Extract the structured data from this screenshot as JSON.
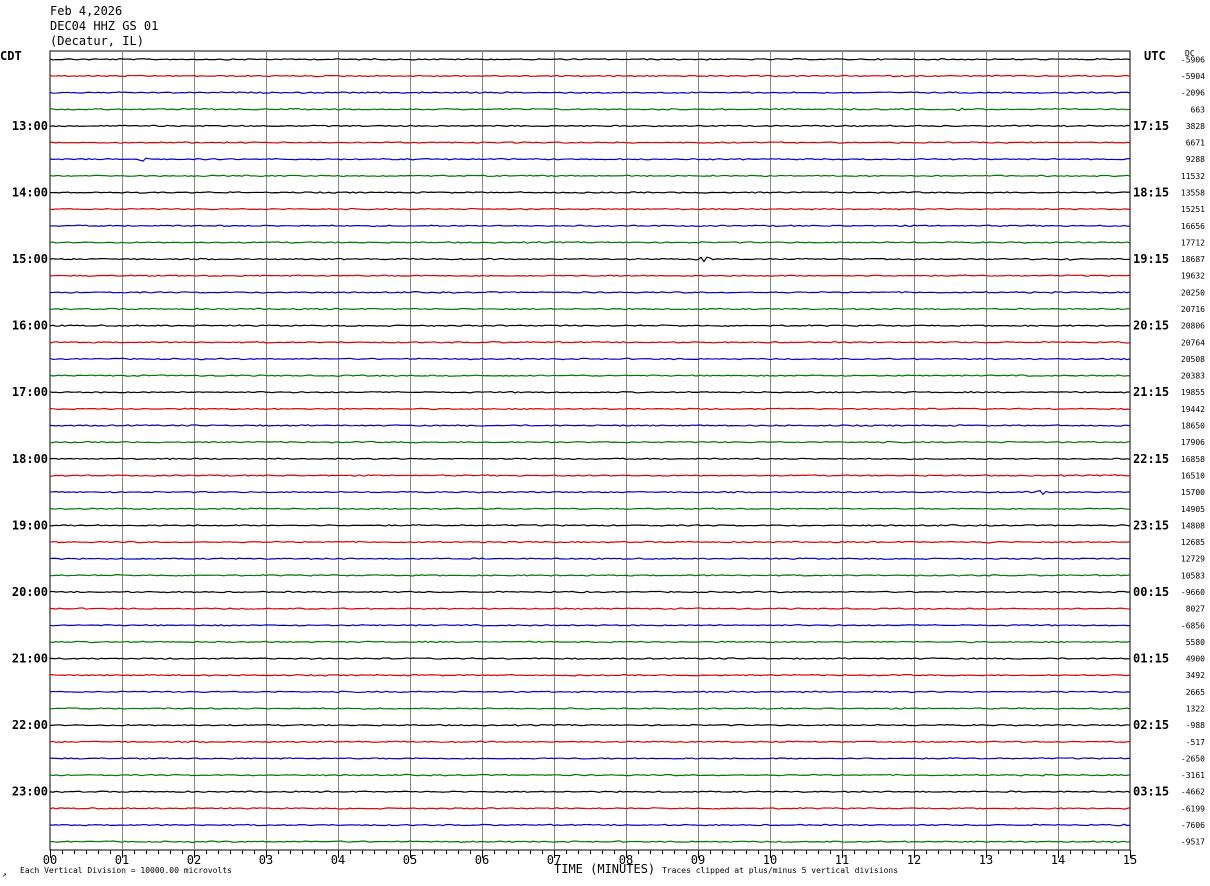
{
  "header": {
    "date": "Feb 4,2026",
    "station": "DEC04 HHZ GS 01",
    "location": "(Decatur, IL)"
  },
  "left_timezone": "CDT",
  "right_timezone": "UTC",
  "dc_header": "DC",
  "footer": {
    "scale_note": "Each Vertical Division = 10000.00 microvolts",
    "x_axis_title": "TIME (MINUTES)",
    "clip_note": "Traces clipped at plus/minus 5 vertical divisions",
    "corner_mark": "↗"
  },
  "colors": {
    "trace_cycle": [
      "#000000",
      "#dd0000",
      "#0000cc",
      "#007700"
    ],
    "grid": "#888888"
  },
  "chart_data": {
    "type": "line",
    "subtype": "helicorder",
    "x_ticks": [
      "00",
      "01",
      "02",
      "03",
      "04",
      "05",
      "06",
      "07",
      "08",
      "09",
      "10",
      "11",
      "12",
      "13",
      "14",
      "15"
    ],
    "xlim": [
      0,
      15
    ],
    "trace_count": 48,
    "left_hour_labels": [
      {
        "trace": 4,
        "text": "13:00"
      },
      {
        "trace": 8,
        "text": "14:00"
      },
      {
        "trace": 12,
        "text": "15:00"
      },
      {
        "trace": 16,
        "text": "16:00"
      },
      {
        "trace": 20,
        "text": "17:00"
      },
      {
        "trace": 24,
        "text": "18:00"
      },
      {
        "trace": 28,
        "text": "19:00"
      },
      {
        "trace": 32,
        "text": "20:00"
      },
      {
        "trace": 36,
        "text": "21:00"
      },
      {
        "trace": 40,
        "text": "22:00"
      },
      {
        "trace": 44,
        "text": "23:00"
      }
    ],
    "right_hour_labels": [
      {
        "trace": 4,
        "text": "17:15"
      },
      {
        "trace": 8,
        "text": "18:15"
      },
      {
        "trace": 12,
        "text": "19:15"
      },
      {
        "trace": 16,
        "text": "20:15"
      },
      {
        "trace": 20,
        "text": "21:15"
      },
      {
        "trace": 24,
        "text": "22:15"
      },
      {
        "trace": 28,
        "text": "23:15"
      },
      {
        "trace": 32,
        "text": "00:15"
      },
      {
        "trace": 36,
        "text": "01:15"
      },
      {
        "trace": 40,
        "text": "02:15"
      },
      {
        "trace": 44,
        "text": "03:15"
      }
    ],
    "dc_offsets": [
      "-5906",
      "-5904",
      "-2096",
      "663",
      "3828",
      "6671",
      "9288",
      "11532",
      "13558",
      "15251",
      "16656",
      "17712",
      "18687",
      "19632",
      "20250",
      "20716",
      "20806",
      "20764",
      "20508",
      "20383",
      "19855",
      "19442",
      "18650",
      "17906",
      "16858",
      "16510",
      "15700",
      "14905",
      "14808",
      "12685",
      "12729",
      "10583",
      "-9660",
      "8027",
      "-6856",
      "5580",
      "4900",
      "3492",
      "2665",
      "1322",
      "-988",
      "-517",
      "-2650",
      "-3161",
      "-4662",
      "-6199",
      "-7606",
      "-9517"
    ],
    "events": [
      {
        "trace": 6,
        "minute": 1.3,
        "amplitude": 0.5
      },
      {
        "trace": 12,
        "minute": 9.1,
        "amplitude": 0.8
      },
      {
        "trace": 12,
        "minute": 14.1,
        "amplitude": 0.4
      },
      {
        "trace": 26,
        "minute": 13.8,
        "amplitude": 0.5
      },
      {
        "trace": 3,
        "minute": 12.6,
        "amplitude": 0.4
      },
      {
        "trace": 29,
        "minute": 13.0,
        "amplitude": 0.3
      }
    ]
  }
}
